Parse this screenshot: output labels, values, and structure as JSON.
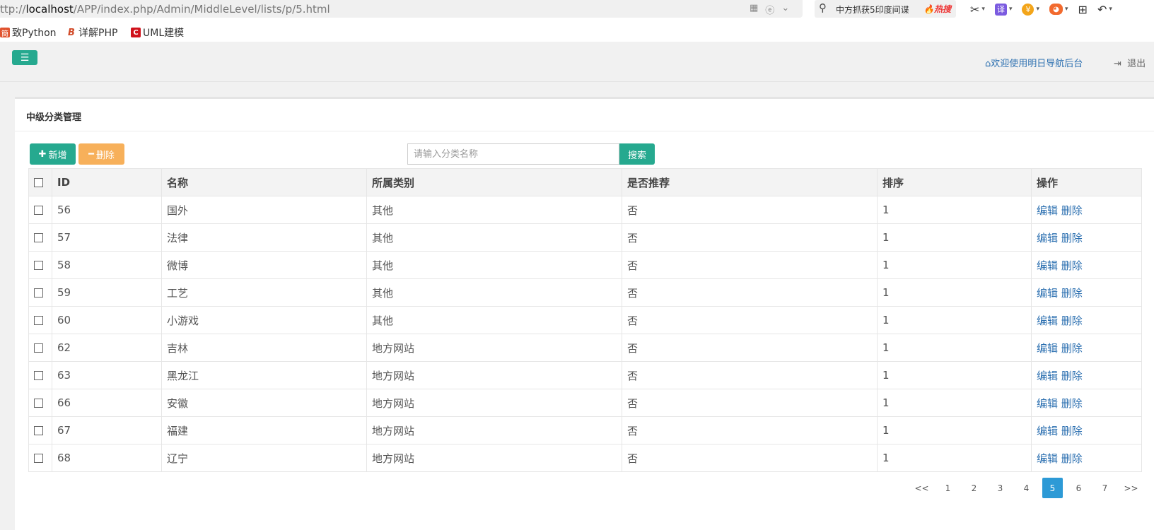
{
  "browser": {
    "url_prefix": "ttp://",
    "url_host": "localhost",
    "url_path": "/APP/index.php/Admin/MiddleLevel/lists/p/5.html",
    "search_text": "中方抓获5印度间谍",
    "search_hot": "热搜"
  },
  "bookmarks": [
    {
      "icon": "簡",
      "label": "致Python"
    },
    {
      "icon": "B",
      "label": "详解PHP"
    },
    {
      "icon": "C",
      "label": "UML建模"
    }
  ],
  "header": {
    "welcome": "欢迎使用明日导航后台",
    "logout": "退出"
  },
  "panel": {
    "title": "中级分类管理",
    "add_label": "新增",
    "delete_label": "删除",
    "search_placeholder": "请输入分类名称",
    "search_button": "搜索"
  },
  "table": {
    "headers": [
      "ID",
      "名称",
      "所属类别",
      "是否推荐",
      "排序",
      "操作"
    ],
    "rows": [
      {
        "id": "56",
        "name": "国外",
        "category": "其他",
        "recommend": "否",
        "sort": "1"
      },
      {
        "id": "57",
        "name": "法律",
        "category": "其他",
        "recommend": "否",
        "sort": "1"
      },
      {
        "id": "58",
        "name": "微博",
        "category": "其他",
        "recommend": "否",
        "sort": "1"
      },
      {
        "id": "59",
        "name": "工艺",
        "category": "其他",
        "recommend": "否",
        "sort": "1"
      },
      {
        "id": "60",
        "name": "小游戏",
        "category": "其他",
        "recommend": "否",
        "sort": "1"
      },
      {
        "id": "62",
        "name": "吉林",
        "category": "地方网站",
        "recommend": "否",
        "sort": "1"
      },
      {
        "id": "63",
        "name": "黑龙江",
        "category": "地方网站",
        "recommend": "否",
        "sort": "1"
      },
      {
        "id": "66",
        "name": "安徽",
        "category": "地方网站",
        "recommend": "否",
        "sort": "1"
      },
      {
        "id": "67",
        "name": "福建",
        "category": "地方网站",
        "recommend": "否",
        "sort": "1"
      },
      {
        "id": "68",
        "name": "辽宁",
        "category": "地方网站",
        "recommend": "否",
        "sort": "1"
      }
    ],
    "edit_label": "编辑",
    "delete_label": "删除"
  },
  "pagination": {
    "pages": [
      "<<",
      "1",
      "2",
      "3",
      "4",
      "5",
      "6",
      "7",
      ">>"
    ],
    "current": "5"
  },
  "colors": {
    "primary": "#26a98f",
    "warning": "#f7b05a",
    "link": "#2b6fb0",
    "page_active": "#2d9ad6"
  }
}
